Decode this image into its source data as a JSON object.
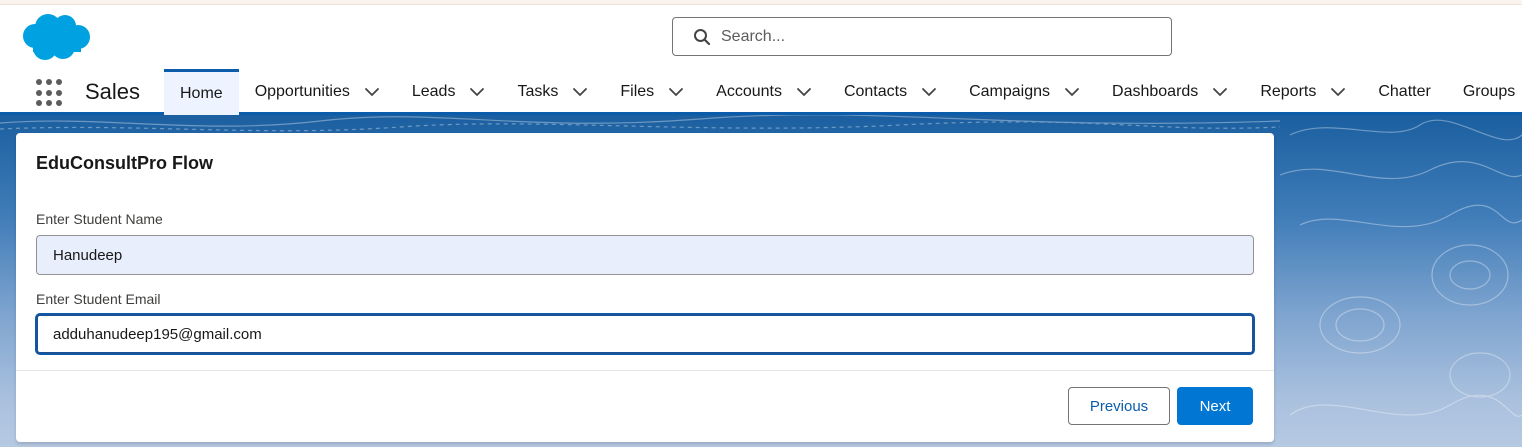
{
  "header": {
    "search": {
      "placeholder": "Search..."
    }
  },
  "nav": {
    "app_name": "Sales",
    "items": [
      {
        "label": "Home",
        "dropdown": false,
        "active": true
      },
      {
        "label": "Opportunities",
        "dropdown": true
      },
      {
        "label": "Leads",
        "dropdown": true
      },
      {
        "label": "Tasks",
        "dropdown": true
      },
      {
        "label": "Files",
        "dropdown": true
      },
      {
        "label": "Accounts",
        "dropdown": true
      },
      {
        "label": "Contacts",
        "dropdown": true
      },
      {
        "label": "Campaigns",
        "dropdown": true
      },
      {
        "label": "Dashboards",
        "dropdown": true
      },
      {
        "label": "Reports",
        "dropdown": true
      },
      {
        "label": "Chatter",
        "dropdown": false
      },
      {
        "label": "Groups",
        "dropdown": false
      }
    ]
  },
  "flow": {
    "title": "EduConsultPro Flow",
    "fields": [
      {
        "label": "Enter Student Name",
        "value": "Hanudeep"
      },
      {
        "label": "Enter Student Email",
        "value": "adduhanudeep195@gmail.com"
      }
    ],
    "buttons": {
      "previous": "Previous",
      "next": "Next"
    }
  },
  "colors": {
    "brand": "#0176d3",
    "nav_accent": "#0b5cab",
    "logo": "#00a1e0"
  }
}
